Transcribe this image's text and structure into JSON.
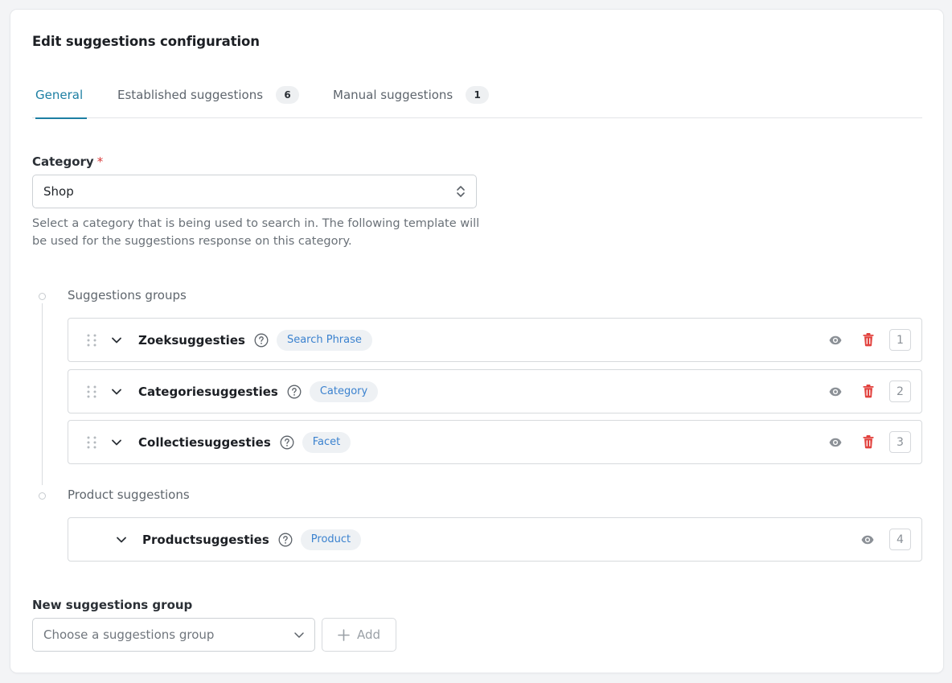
{
  "header": {
    "title": "Edit suggestions configuration"
  },
  "tabs": [
    {
      "label": "General",
      "active": true
    },
    {
      "label": "Established suggestions",
      "badge": "6"
    },
    {
      "label": "Manual suggestions",
      "badge": "1"
    }
  ],
  "category": {
    "label": "Category",
    "required_mark": "*",
    "value": "Shop",
    "help": "Select a category that is being used to search in. The following template will be used for the suggestions response on this category."
  },
  "sections": {
    "suggestions_groups": "Suggestions groups",
    "product_suggestions": "Product suggestions"
  },
  "groups": [
    {
      "name": "Zoeksuggesties",
      "tag": "Search Phrase",
      "order": "1"
    },
    {
      "name": "Categoriesuggesties",
      "tag": "Category",
      "order": "2"
    },
    {
      "name": "Collectiesuggesties",
      "tag": "Facet",
      "order": "3"
    }
  ],
  "product_group": {
    "name": "Productsuggesties",
    "tag": "Product",
    "order": "4"
  },
  "new_group": {
    "label": "New suggestions group",
    "placeholder": "Choose a suggestions group",
    "add_label": "Add"
  },
  "colors": {
    "accent": "#1d7fa3",
    "danger": "#e2413d",
    "tag_text": "#3b82cf"
  }
}
